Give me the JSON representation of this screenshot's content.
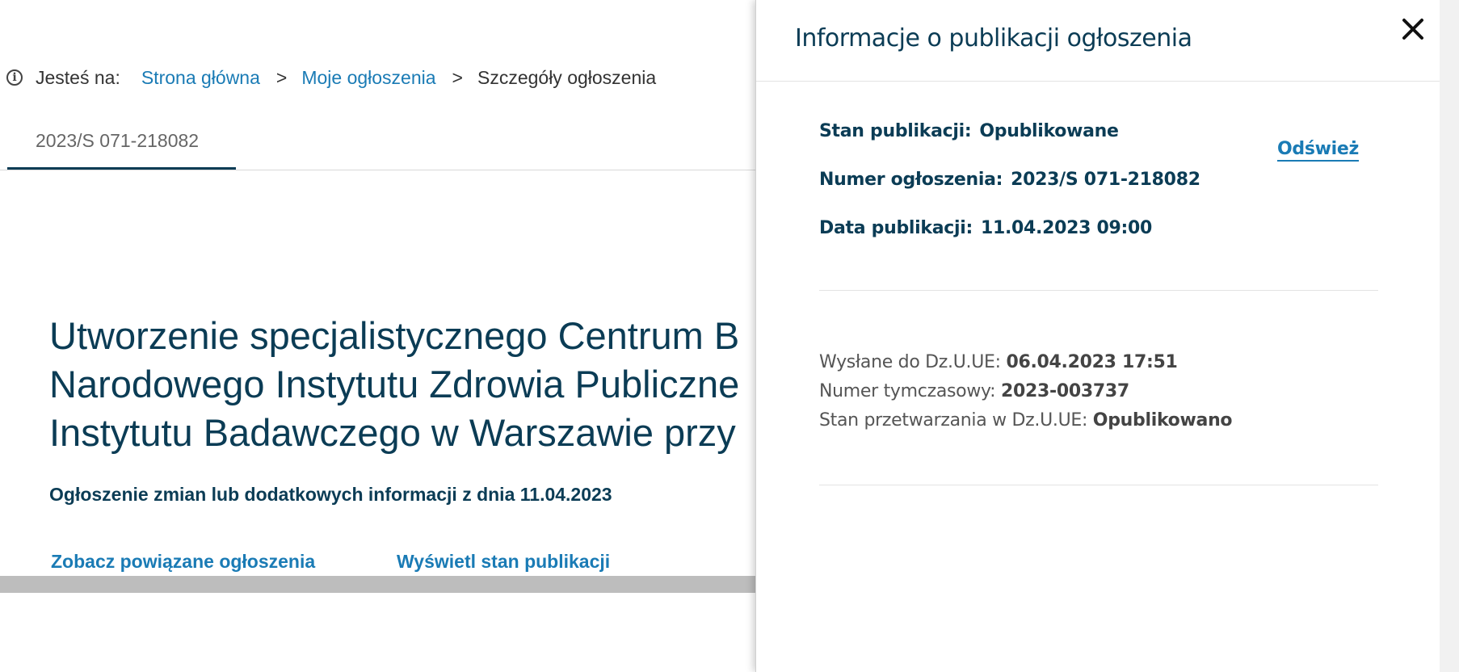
{
  "breadcrumb": {
    "label": "Jesteś na:",
    "items": [
      "Strona główna",
      "Moje ogłoszenia",
      "Szczegóły ogłoszenia"
    ],
    "separator": ">"
  },
  "tabs": [
    {
      "label": "2023/S 071-218082"
    }
  ],
  "notice": {
    "title_lines": [
      "Utworzenie specjalistycznego Centrum B",
      "Narodowego Instytutu Zdrowia Publiczne",
      "Instytutu Badawczego w Warszawie przy"
    ],
    "subtitle": "Ogłoszenie zmian lub dodatkowych informacji z dnia 11.04.2023",
    "related_link": "Zobacz powiązane ogłoszenia",
    "status_link": "Wyświetl stan publikacji"
  },
  "panel": {
    "title": "Informacje o publikacji ogłoszenia",
    "close_icon": "close-icon",
    "refresh_label": "Odśwież",
    "status": {
      "label": "Stan publikacji:",
      "value": "Opublikowane"
    },
    "number": {
      "label": "Numer ogłoszenia:",
      "value": "2023/S 071-218082"
    },
    "date": {
      "label": "Data publikacji:",
      "value": "11.04.2023 09:00"
    },
    "sent": {
      "label": "Wysłane do Dz.U.UE:",
      "value": "06.04.2023 17:51"
    },
    "temp_number": {
      "label": "Numer tymczasowy:",
      "value": "2023-003737"
    },
    "processing": {
      "label": "Stan przetwarzania w Dz.U.UE:",
      "value": "Opublikowano"
    }
  },
  "colors": {
    "primary": "#0b3c55",
    "link": "#1a7bb5",
    "scroll_track": "#bdbdbd"
  }
}
